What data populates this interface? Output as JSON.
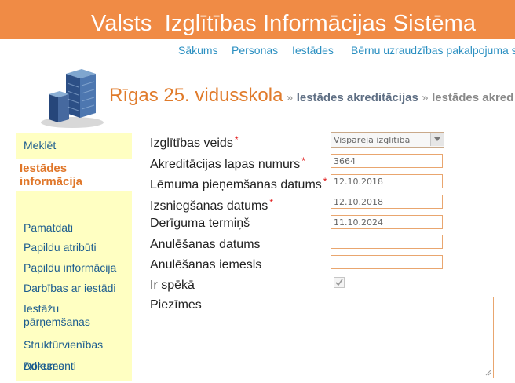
{
  "header": {
    "title": "Valsts  Izglītības Informācijas Sistēma"
  },
  "nav": [
    "Sākums",
    "Personas",
    "Iestādes",
    "Bērnu uzraudzības pakalpojuma s"
  ],
  "page": {
    "school": "Rīgas 25. vidusskola",
    "separator": "»",
    "crumb1": "Iestādes akreditācijas",
    "crumb2": "Iestādes akred"
  },
  "sidebar": {
    "items": [
      "Meklēt",
      "Iestādes informācija",
      "Pamatdati",
      "Papildu atribūti",
      "Papildu informācija",
      "Darbības ar iestādi",
      "Iestāžu pārņemšanas",
      "Struktūrvienības",
      "Dokumenti",
      "Adreses"
    ],
    "active_line1": "Iestādes",
    "active_line2": "informācija",
    "multi_line1": "Iestāžu",
    "multi_line2": "pārņemšanas"
  },
  "form": {
    "required_mark": "*",
    "labels": {
      "type": "Izglītības veids",
      "page_number": "Akreditācijas lapas numurs",
      "decision_date": "Lēmuma pieņemšanas datums",
      "issue_date": "Izsniegšanas datums",
      "valid_until": "Derīguma termiņš",
      "cancel_date": "Anulēšanas datums",
      "cancel_reason": "Anulēšanas iemesls",
      "in_force": "Ir spēkā",
      "notes": "Piezīmes"
    },
    "values": {
      "type": "Vispārējā izglītība",
      "page_number": "3664",
      "decision_date": "12.10.2018",
      "issue_date": "12.10.2018",
      "valid_until": "11.10.2024",
      "cancel_date": "",
      "cancel_reason": ""
    },
    "in_force_checked": true
  },
  "colors": {
    "brand": "#f08b45",
    "link": "#2a8fc1",
    "sidebar_bg": "#ffffc2",
    "active": "#e0772a",
    "required": "#e01010"
  }
}
